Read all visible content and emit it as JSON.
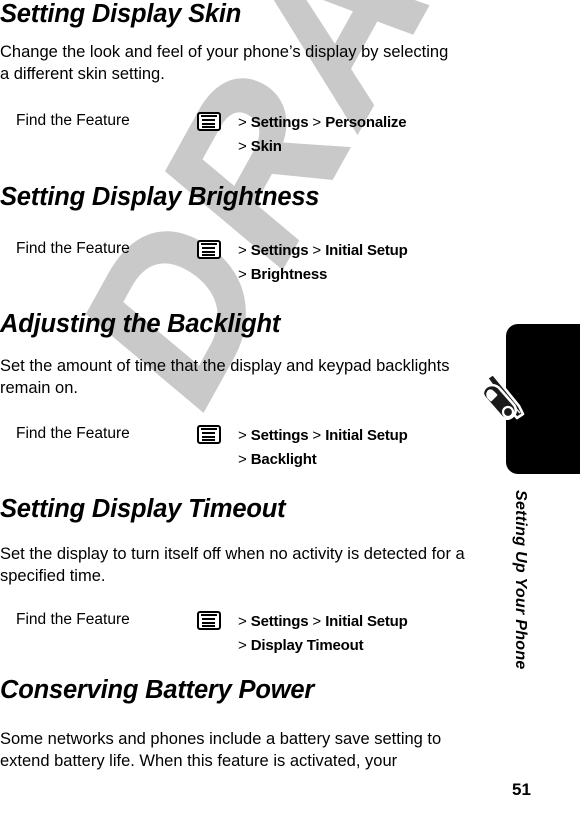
{
  "document": {
    "page_number": "51",
    "watermark_text": "DRAFT",
    "margin_tab": {
      "label": "Setting Up Your Phone",
      "icon": "wrench-screwdriver-icon"
    }
  },
  "find_the_feature_label": "Find the Feature",
  "menu_icon_name": "menu-key-icon",
  "sections": [
    {
      "title": "Setting Display Skin",
      "body": "Change the look and feel of your phone’s display by selecting a different skin setting.",
      "feature": {
        "label": "Find the Feature",
        "lines": [
          [
            {
              "sep": ">",
              "cmd": "Settings"
            },
            {
              "sep": ">",
              "cmd": "Personalize"
            }
          ],
          [
            {
              "sep": ">",
              "cmd": "Skin"
            }
          ]
        ]
      }
    },
    {
      "title": "Setting Display Brightness",
      "body": "",
      "feature": {
        "label": "Find the Feature",
        "lines": [
          [
            {
              "sep": ">",
              "cmd": "Settings"
            },
            {
              "sep": ">",
              "cmd": "Initial Setup"
            }
          ],
          [
            {
              "sep": ">",
              "cmd": "Brightness"
            }
          ]
        ]
      }
    },
    {
      "title": "Adjusting the Backlight",
      "body": "Set the amount of time that the display and keypad backlights remain on.",
      "feature": {
        "label": "Find the Feature",
        "lines": [
          [
            {
              "sep": ">",
              "cmd": "Settings"
            },
            {
              "sep": ">",
              "cmd": "Initial Setup"
            }
          ],
          [
            {
              "sep": ">",
              "cmd": "Backlight"
            }
          ]
        ]
      }
    },
    {
      "title": "Setting Display Timeout",
      "body": "Set the display to turn itself off when no activity is detected for a specified time.",
      "feature": {
        "label": "Find the Feature",
        "lines": [
          [
            {
              "sep": ">",
              "cmd": "Settings"
            },
            {
              "sep": ">",
              "cmd": "Initial Setup"
            }
          ],
          [
            {
              "sep": ">",
              "cmd": "Display Timeout"
            }
          ]
        ]
      }
    },
    {
      "title": "Conserving Battery Power",
      "body": "Some networks and phones include a battery save setting to extend battery life. When this feature is activated, your",
      "feature": null
    }
  ],
  "colors": {
    "text": "#000000",
    "watermark": "#c9c9c9",
    "tab": "#000000",
    "page_background": "#ffffff"
  }
}
